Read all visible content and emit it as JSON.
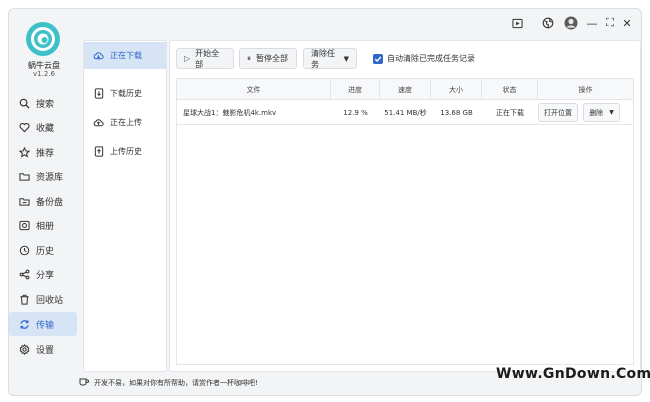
{
  "app": {
    "name": "蜗牛云盘",
    "version": "v1.2.6"
  },
  "titlebar": {
    "icons": [
      "play-square-icon",
      "globe-icon",
      "avatar",
      "minimize-icon",
      "maximize-icon",
      "close-icon"
    ],
    "minimize": "—",
    "maximize": "⛶",
    "close": "✕"
  },
  "nav": {
    "items": [
      {
        "label": "搜索",
        "icon": "search-icon"
      },
      {
        "label": "收藏",
        "icon": "heart-icon"
      },
      {
        "label": "推荐",
        "icon": "star-icon"
      },
      {
        "label": "资源库",
        "icon": "folder-icon"
      },
      {
        "label": "备份盘",
        "icon": "backup-folder-icon"
      },
      {
        "label": "相册",
        "icon": "camera-icon"
      },
      {
        "label": "历史",
        "icon": "history-icon"
      },
      {
        "label": "分享",
        "icon": "share-icon"
      },
      {
        "label": "回收站",
        "icon": "trash-icon"
      },
      {
        "label": "传输",
        "icon": "transfer-icon",
        "active": true
      },
      {
        "label": "设置",
        "icon": "gear-icon"
      }
    ]
  },
  "subnav": {
    "items": [
      {
        "label": "正在下载",
        "icon": "cloud-download-icon",
        "active": true
      },
      {
        "label": "下载历史",
        "icon": "download-history-icon"
      },
      {
        "label": "正在上传",
        "icon": "cloud-upload-icon"
      },
      {
        "label": "上传历史",
        "icon": "upload-history-icon"
      }
    ]
  },
  "toolbar": {
    "start_all": "开始全部",
    "pause_all": "暂停全部",
    "clear_tasks": "清除任务",
    "auto_clear_label": "自动清除已完成任务记录",
    "auto_clear_checked": true
  },
  "table": {
    "headers": {
      "file": "文件",
      "progress": "进度",
      "speed": "速度",
      "size": "大小",
      "status": "状态",
      "actions": "操作"
    },
    "rows": [
      {
        "file": "星球大战1：魅影危机4k.mkv",
        "progress": "12.9 %",
        "speed": "51.41 MB/秒",
        "size": "13.68 GB",
        "status": "正在下载",
        "open_location": "打开位置",
        "delete": "删除"
      }
    ]
  },
  "footer": {
    "text": "开发不易，如果对你有所帮助，请赏作者一杯咖啡吧!"
  },
  "watermark": "Www.GnDown.Com",
  "colors": {
    "accent": "#2f67c9",
    "active_bg": "#d6e4f6",
    "logo": "#3ec0c9"
  }
}
